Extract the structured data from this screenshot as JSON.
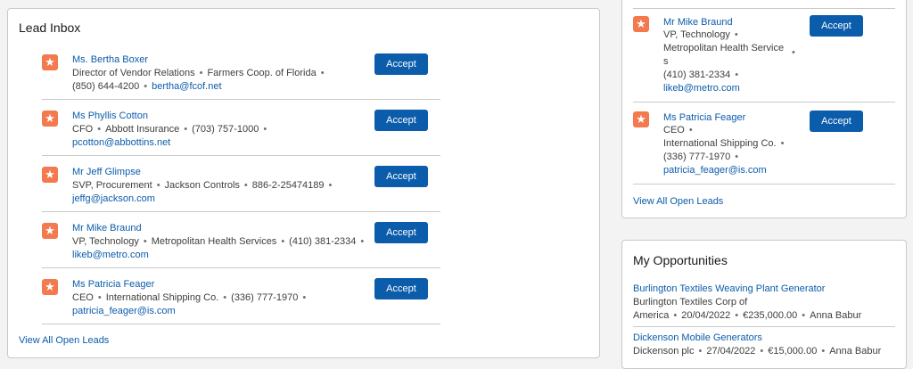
{
  "lead_inbox": {
    "title": "Lead Inbox",
    "leads": [
      {
        "name": "Ms. Bertha Boxer",
        "title": "Director of Vendor Relations",
        "company": "Farmers Coop. of Florida",
        "phone": "(850) 644-4200",
        "email": "bertha@fcof.net",
        "accept_label": "Accept"
      },
      {
        "name": "Ms Phyllis Cotton",
        "title": "CFO",
        "company": "Abbott Insurance",
        "phone": "(703) 757-1000",
        "email": "pcotton@abbottins.net",
        "accept_label": "Accept"
      },
      {
        "name": "Mr Jeff Glimpse",
        "title": "SVP, Procurement",
        "company": "Jackson Controls",
        "phone": "886-2-25474189",
        "email": "jeffg@jackson.com",
        "accept_label": "Accept"
      },
      {
        "name": "Mr Mike Braund",
        "title": "VP, Technology",
        "company": "Metropolitan Health Services",
        "phone": "(410) 381-2334",
        "email": "likeb@metro.com",
        "accept_label": "Accept"
      },
      {
        "name": "Ms Patricia Feager",
        "title": "CEO",
        "company": "International Shipping Co.",
        "phone": "(336) 777-1970",
        "email": "patricia_feager@is.com",
        "accept_label": "Accept"
      }
    ],
    "view_all_label": "View All Open Leads"
  },
  "right_leads": {
    "leads": [
      {
        "name": "Mr Mike Braund",
        "title": "VP, Technology",
        "company_line1": "Metropolitan Health Service",
        "company_line2": "s",
        "phone": "(410) 381-2334",
        "email": "likeb@metro.com",
        "accept_label": "Accept"
      },
      {
        "name": "Ms Patricia Feager",
        "title": "CEO",
        "company_line1": "International Shipping Co.",
        "company_line2": "",
        "phone": "(336) 777-1970",
        "email": "patricia_feager@is.com",
        "accept_label": "Accept"
      }
    ],
    "view_all_label": "View All Open Leads"
  },
  "opportunities": {
    "title": "My Opportunities",
    "items": [
      {
        "name": "Burlington Textiles Weaving Plant Generator",
        "line1": "Burlington Textiles Corp of",
        "account_end": "America",
        "date": "20/04/2022",
        "amount": "€235,000.00",
        "owner": "Anna Babur"
      },
      {
        "name": "Dickenson Mobile Generators",
        "line1": "",
        "account_end": "Dickenson plc",
        "date": "27/04/2022",
        "amount": "€15,000.00",
        "owner": "Anna Babur"
      }
    ]
  },
  "icons": {
    "lead": "lead-star-icon"
  },
  "colors": {
    "accent": "#0b5cab",
    "lead_icon": "#f3794f"
  },
  "sep": "•"
}
